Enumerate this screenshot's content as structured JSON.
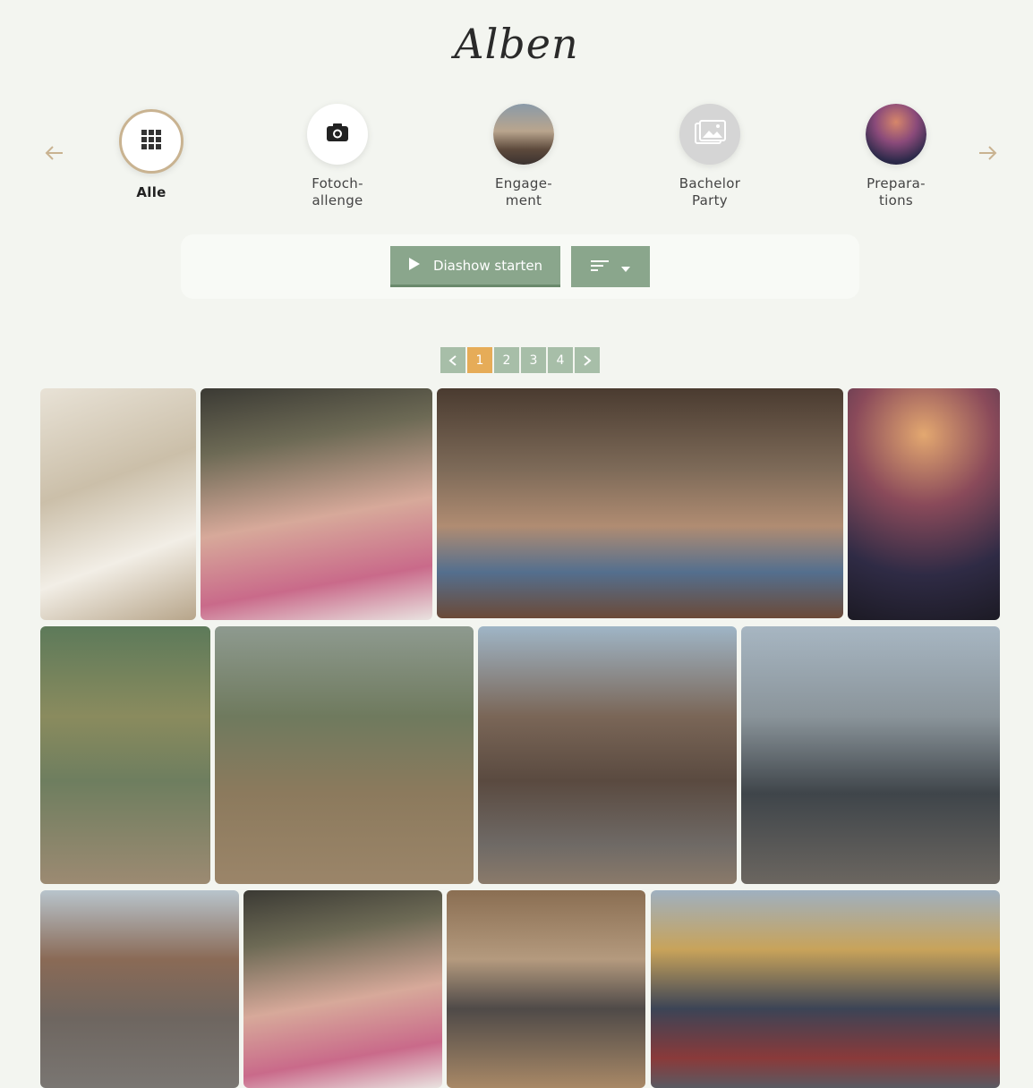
{
  "page": {
    "title": "Alben"
  },
  "nav": {
    "prev_icon": "arrow-left-icon",
    "next_icon": "arrow-right-icon"
  },
  "categories": [
    {
      "label": "Alle",
      "icon": "grid-icon",
      "active": true
    },
    {
      "label": "Fotoch-\nallenge",
      "icon": "camera-icon",
      "active": false
    },
    {
      "label": "Engage-\nment",
      "icon": "photo-thumbnail",
      "active": false
    },
    {
      "label": "Bachelor\nParty",
      "icon": "image-placeholder-icon",
      "active": false
    },
    {
      "label": "Prepara-\ntions",
      "icon": "photo-thumbnail",
      "active": false
    }
  ],
  "toolbar": {
    "slideshow_label": "Diashow starten",
    "sort_icon": "sort-icon",
    "dropdown_icon": "caret-down-icon"
  },
  "pagination": {
    "pages": [
      "1",
      "2",
      "3",
      "4"
    ],
    "current": "1"
  },
  "colors": {
    "background": "#f3f5f0",
    "accent_green": "#8aa68c",
    "accent_gold": "#c9b391",
    "active_page": "#e6ac58"
  }
}
